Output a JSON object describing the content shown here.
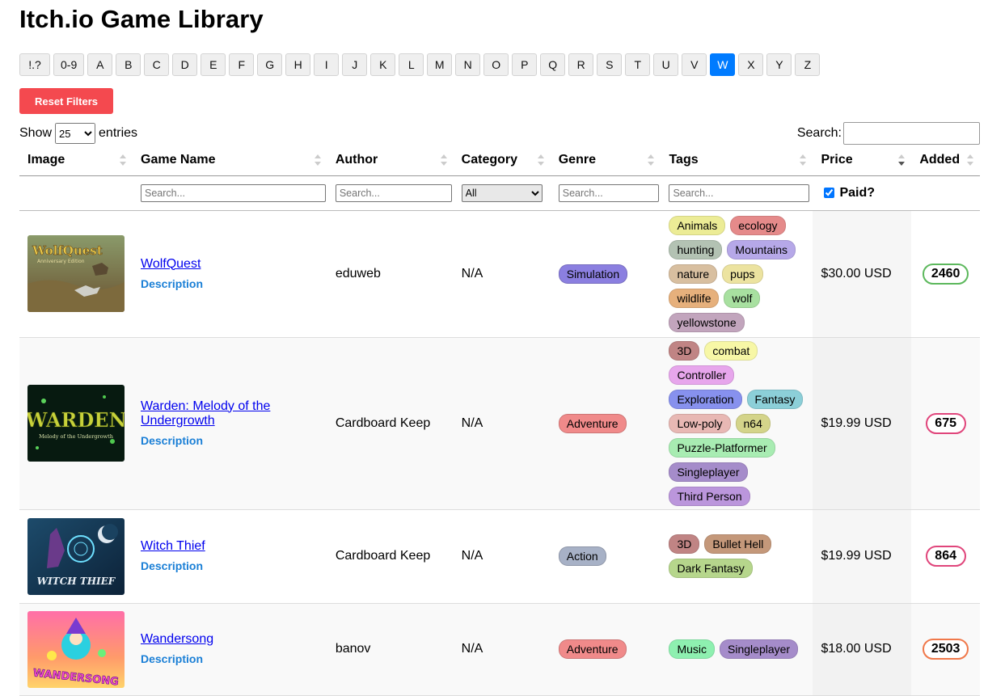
{
  "page_title": "Itch.io Game Library",
  "alpha_filter": {
    "letters": [
      "!.?",
      "0-9",
      "A",
      "B",
      "C",
      "D",
      "E",
      "F",
      "G",
      "H",
      "I",
      "J",
      "K",
      "L",
      "M",
      "N",
      "O",
      "P",
      "Q",
      "R",
      "S",
      "T",
      "U",
      "V",
      "W",
      "X",
      "Y",
      "Z"
    ],
    "active": "W"
  },
  "reset_label": "Reset Filters",
  "show_entries": {
    "prefix": "Show",
    "value": "25",
    "suffix": "entries"
  },
  "search": {
    "label": "Search:",
    "value": ""
  },
  "columns": [
    "Image",
    "Game Name",
    "Author",
    "Category",
    "Genre",
    "Tags",
    "Price",
    "Added"
  ],
  "filters": {
    "game_name_placeholder": "Search...",
    "author_placeholder": "Search...",
    "category_value": "All",
    "genre_placeholder": "Search...",
    "tags_placeholder": "Search...",
    "paid_label": "Paid?",
    "paid_checked": true
  },
  "games": [
    {
      "name": "WolfQuest",
      "description": "Description",
      "author": "eduweb",
      "category": "N/A",
      "genre": "Simulation",
      "genre_color": "#8b7fe0",
      "tags": [
        {
          "label": "Animals",
          "color": "#ecec96"
        },
        {
          "label": "ecology",
          "color": "#e58a8a"
        },
        {
          "label": "hunting",
          "color": "#b3c2b3"
        },
        {
          "label": "Mountains",
          "color": "#b6a8e8"
        },
        {
          "label": "nature",
          "color": "#d8bfa0"
        },
        {
          "label": "pups",
          "color": "#ece3a0"
        },
        {
          "label": "wildlife",
          "color": "#e6b07c"
        },
        {
          "label": "wolf",
          "color": "#a8e0a0"
        },
        {
          "label": "yellowstone",
          "color": "#c2a5bd"
        }
      ],
      "price": "$30.00 USD",
      "added": "2460",
      "added_color": "#5cb85c",
      "image_text": "WolfQuest",
      "image_subtext": "Anniversary Edition"
    },
    {
      "name": "Warden: Melody of the Undergrowth",
      "description": "Description",
      "author": "Cardboard Keep",
      "category": "N/A",
      "genre": "Adventure",
      "genre_color": "#f08a8a",
      "tags": [
        {
          "label": "3D",
          "color": "#c08484"
        },
        {
          "label": "combat",
          "color": "#f7f7a6"
        },
        {
          "label": "Controller",
          "color": "#e7a6ec"
        },
        {
          "label": "Exploration",
          "color": "#8791ee"
        },
        {
          "label": "Fantasy",
          "color": "#8ccfd8"
        },
        {
          "label": "Low-poly",
          "color": "#e8b8b4"
        },
        {
          "label": "n64",
          "color": "#d4d48a"
        },
        {
          "label": "Puzzle-Platformer",
          "color": "#a8ecb2"
        },
        {
          "label": "Singleplayer",
          "color": "#a58cca"
        },
        {
          "label": "Third Person",
          "color": "#bb96dc"
        }
      ],
      "price": "$19.99 USD",
      "added": "675",
      "added_color": "#e0457b",
      "image_text": "WARDEN",
      "image_subtext": "Melody of the Undergrowth"
    },
    {
      "name": "Witch Thief",
      "description": "Description",
      "author": "Cardboard Keep",
      "category": "N/A",
      "genre": "Action",
      "genre_color": "#a7b1c6",
      "tags": [
        {
          "label": "3D",
          "color": "#c08484"
        },
        {
          "label": "Bullet Hell",
          "color": "#c4987a"
        },
        {
          "label": "Dark Fantasy",
          "color": "#b6d68c"
        }
      ],
      "price": "$19.99 USD",
      "added": "864",
      "added_color": "#e0457b",
      "image_text": "WITCH THIEF",
      "image_subtext": ""
    },
    {
      "name": "Wandersong",
      "description": "Description",
      "author": "banov",
      "category": "N/A",
      "genre": "Adventure",
      "genre_color": "#f08a8a",
      "tags": [
        {
          "label": "Music",
          "color": "#8ef0b0"
        },
        {
          "label": "Singleplayer",
          "color": "#a58cca"
        }
      ],
      "price": "$18.00 USD",
      "added": "2503",
      "added_color": "#f0784a",
      "image_text": "WANDERSONG",
      "image_subtext": ""
    }
  ]
}
